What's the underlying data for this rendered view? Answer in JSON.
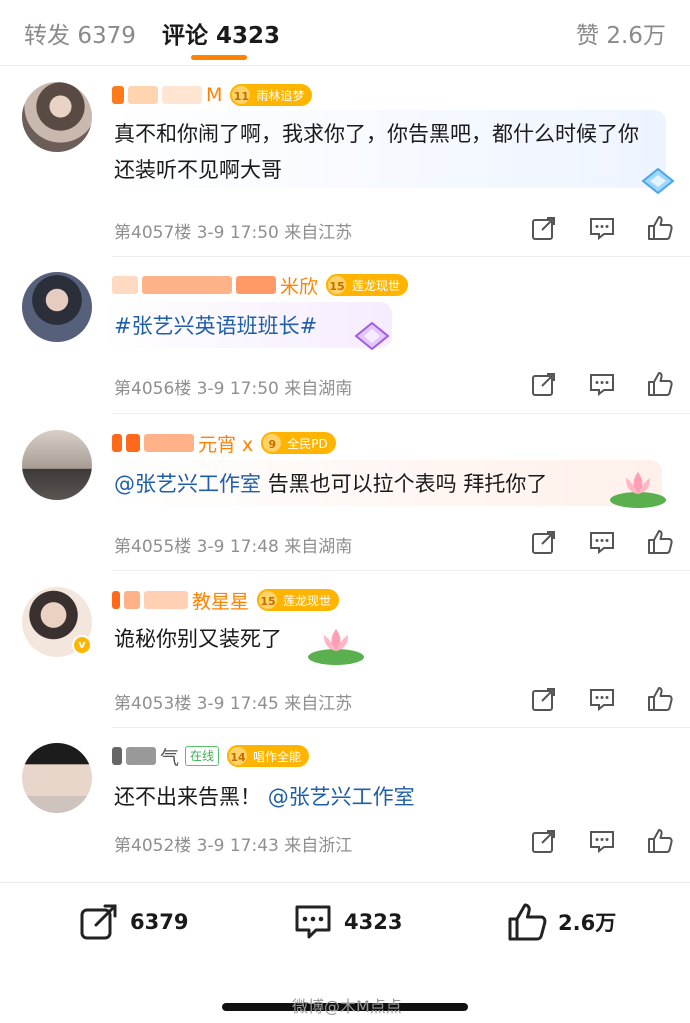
{
  "tabs": {
    "repost_label": "转发",
    "repost_count": "6379",
    "comment_label": "评论",
    "comment_count": "4323",
    "like_label": "赞",
    "like_count": "2.6万"
  },
  "comments": [
    {
      "name_visible": "M",
      "level": "11",
      "badge": "雨林追梦",
      "content": "真不和你闹了啊，我求你了，你告黑吧，都什么时候了你还装听不见啊大哥",
      "floor": "第4057楼",
      "time": "3-9 17:50",
      "location": "来自江苏"
    },
    {
      "name_visible": "米欣",
      "level": "15",
      "badge": "莲龙现世",
      "content": "#张艺兴英语班班长#",
      "floor": "第4056楼",
      "time": "3-9 17:50",
      "location": "来自湖南"
    },
    {
      "name_visible": "元宵 x",
      "level": "9",
      "badge": "全民PD",
      "mention": "@张艺兴工作室",
      "content": "告黑也可以拉个表吗 拜托你了",
      "floor": "第4055楼",
      "time": "3-9 17:48",
      "location": "来自湖南"
    },
    {
      "name_visible": "教星星",
      "level": "15",
      "badge": "莲龙现世",
      "content": "诡秘你别又装死了",
      "floor": "第4053楼",
      "time": "3-9 17:45",
      "location": "来自江苏"
    },
    {
      "name_visible": "气",
      "online": "在线",
      "level": "14",
      "badge": "唱作全能",
      "content": "还不出来告黑！",
      "mention": "@张艺兴工作室",
      "floor": "第4052楼",
      "time": "3-9 17:43",
      "location": "来自浙江"
    }
  ],
  "bottom_bar": {
    "repost_count": "6379",
    "comment_count": "4323",
    "like_count": "2.6万"
  },
  "watermark": "微博@木M点点",
  "colors": {
    "accent": "#ff8200",
    "link": "#1e5ea8",
    "meta": "#8f8f8f"
  },
  "icons": [
    "share-icon",
    "comment-icon",
    "like-icon",
    "verified-badge-icon",
    "diamond-icon",
    "lotus-icon"
  ]
}
